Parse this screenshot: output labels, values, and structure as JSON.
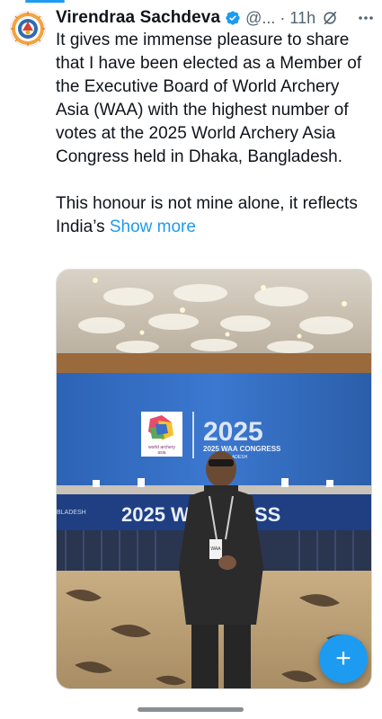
{
  "tweet": {
    "author_name": "Virendraa Sachdeva",
    "handle": "@...",
    "separator": "·",
    "time": "11h",
    "text": "It gives me immense pleasure to share that I have been elected as a Member of the Executive Board of World Archery Asia (WAA) with the highest number of votes at the 2025 World Archery Asia Congress held in Dhaka, Bangladesh.\n\nThis honour is not mine alone, it reflects India’s ",
    "show_more": "Show more",
    "verified_color": "#1d9bf0"
  },
  "media": {
    "backdrop_year": "2025",
    "backdrop_subtitle": "2025 WAA CONGRESS",
    "backdrop_location": "BANGLADESH",
    "logo_text_1": "world archery",
    "logo_text_2": "asia",
    "table_banner": "2025 W    GRESS",
    "table_banner_left": "BLADESH",
    "badge_text": "WAA"
  },
  "fab": {
    "label": "+"
  },
  "colors": {
    "accent": "#1d9bf0"
  }
}
